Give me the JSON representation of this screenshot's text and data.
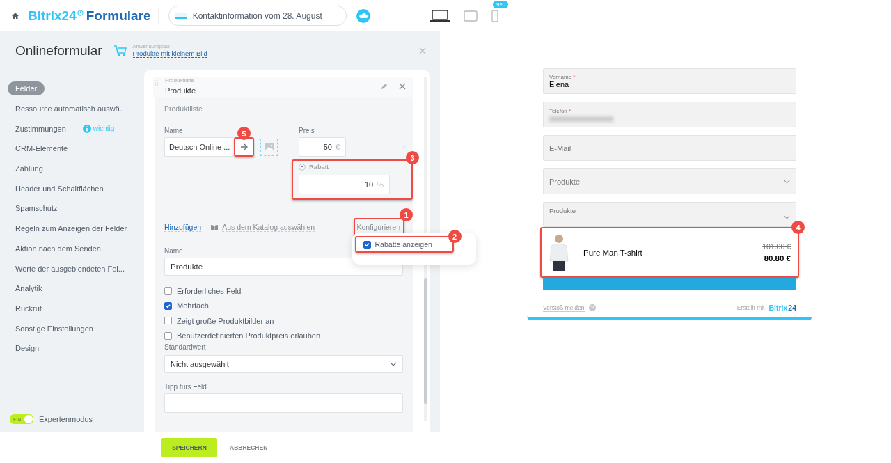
{
  "header": {
    "brand": "Bitrix24",
    "product": "Formulare",
    "form_name": "Kontaktinformation vom 28. August",
    "devices": [
      {
        "kind": "desktop",
        "selected": true
      },
      {
        "kind": "tablet",
        "selected": false
      },
      {
        "kind": "phone",
        "selected": false,
        "badge": "Neu"
      }
    ]
  },
  "panel": {
    "title": "Onlineformular",
    "use_case_label": "Anwendungsfall",
    "use_case": "Produkte mit kleinem Bild"
  },
  "sidebar": {
    "items": [
      {
        "label": "Felder",
        "selected": true
      },
      {
        "label": "Ressource automatisch auswä...",
        "selected": false
      },
      {
        "label": "Zustimmungen",
        "selected": false,
        "badge": "wichtig"
      },
      {
        "label": "CRM-Elemente",
        "selected": false
      },
      {
        "label": "Zahlung",
        "selected": false
      },
      {
        "label": "Header und Schaltflächen",
        "selected": false
      },
      {
        "label": "Spamschutz",
        "selected": false
      },
      {
        "label": "Regeln zum Anzeigen der Felder",
        "selected": false
      },
      {
        "label": "Aktion nach dem Senden",
        "selected": false
      },
      {
        "label": "Werte der ausgeblendeten Fel...",
        "selected": false
      },
      {
        "label": "Analytik",
        "selected": false
      },
      {
        "label": "Rückruf",
        "selected": false
      },
      {
        "label": "Sonstige Einstellungen",
        "selected": false
      },
      {
        "label": "Design",
        "selected": false
      }
    ],
    "expert_mode": {
      "label": "Expertenmodus",
      "toggle_text": "EIN",
      "on": true
    }
  },
  "field_editor": {
    "type_label": "Produktliste",
    "title": "Produkte",
    "section_title": "Produktliste",
    "name_label": "Name",
    "product_name": "Deutsch Online ...",
    "price_label": "Preis",
    "price": "50",
    "currency": "€",
    "discount_label": "Rabatt",
    "discount": "10",
    "discount_unit": "%",
    "add_link": "Hinzufügen",
    "catalog_link": "Aus dem Katalog auswählen",
    "configure_link": "Konfigurieren",
    "popup_option": {
      "label": "Rabatte anzeigen",
      "checked": true
    },
    "field_name_label": "Name",
    "field_name": "Produkte",
    "options": [
      {
        "label": "Erforderliches Feld",
        "checked": false
      },
      {
        "label": "Mehrfach",
        "checked": true
      },
      {
        "label": "Zeigt große Produktbilder an",
        "checked": false
      },
      {
        "label": "Benutzerdefinierten Produktpreis erlauben",
        "checked": false
      }
    ],
    "default_label": "Standardwert",
    "default_value": "Nicht ausgewählt",
    "hint_label": "Tipp fürs Feld"
  },
  "markers": {
    "configure": "1",
    "popup": "2",
    "discount": "3",
    "product": "4",
    "arrow": "5"
  },
  "footer": {
    "save": "SPEICHERN",
    "cancel": "ABBRECHEN"
  },
  "preview": {
    "fields": [
      {
        "kind": "text",
        "label": "Vorname",
        "required_mark": "*",
        "value": "Elena"
      },
      {
        "kind": "blurred",
        "label": "Telefon",
        "required_mark": "*"
      },
      {
        "kind": "placeholder",
        "placeholder": "E-Mail"
      },
      {
        "kind": "select",
        "placeholder": "Produkte"
      },
      {
        "kind": "select-open",
        "label": "Produkte"
      }
    ],
    "product": {
      "name": "Pure Man T-shirt",
      "old_price": "101.00 €",
      "price": "80.80 €"
    },
    "report_link": "Verstoß melden",
    "credit": "Erstellt mit",
    "credit_brand": "Bitrix",
    "credit_brand_num": "24"
  }
}
